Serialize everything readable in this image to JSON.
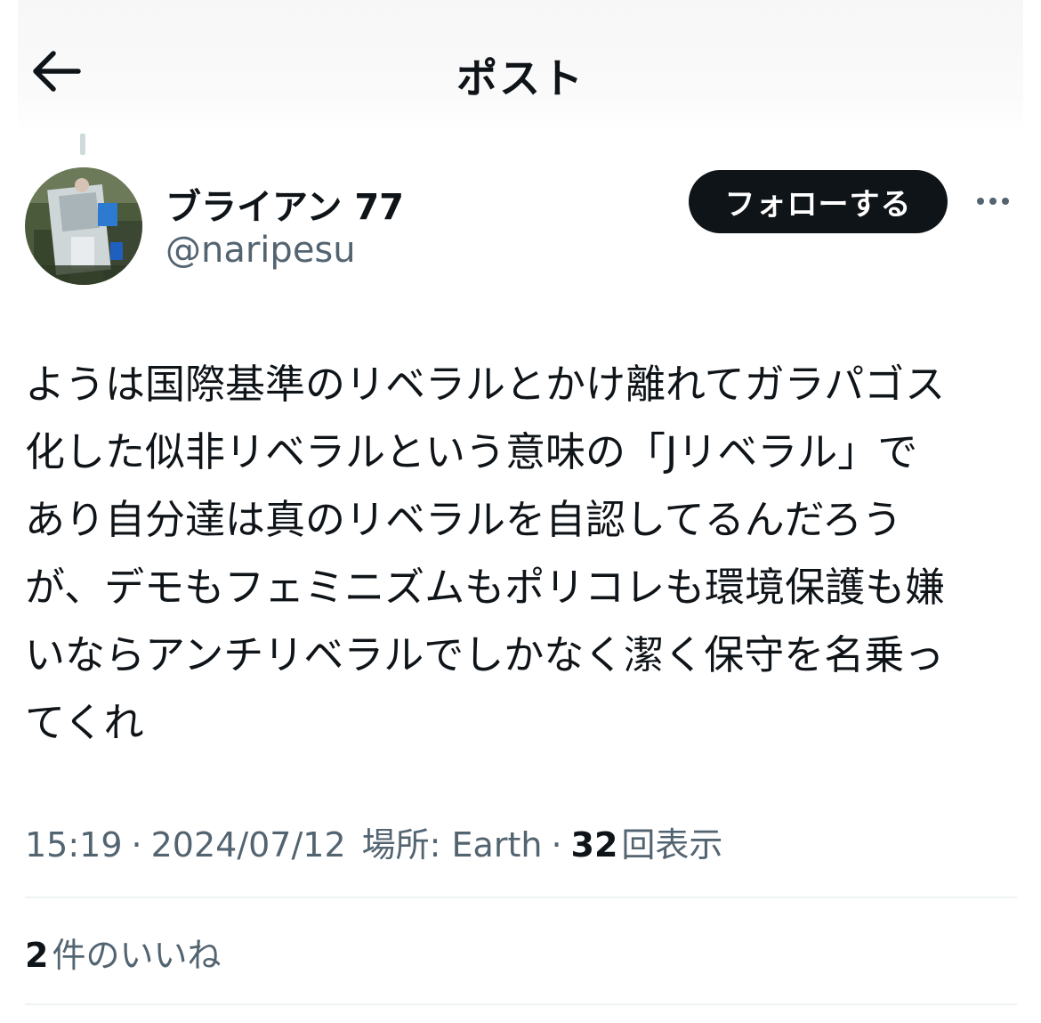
{
  "header": {
    "title": "ポスト",
    "back_icon": "arrow-left-icon"
  },
  "author": {
    "display_name": "ブライアン 77",
    "handle": "@naripesu",
    "avatar_icon": "profile-photo"
  },
  "actions": {
    "follow_label": "フォローする",
    "more_icon": "ellipsis-icon"
  },
  "post": {
    "lines": [
      "ようは国際基準のリベラルとかけ離れてガラパゴス",
      "化した似非リベラルという意味の「Jリベラル」で",
      "あり自分達は真のリベラルを自認してるんだろう",
      "が、デモもフェミニズムもポリコレも環境保護も嫌",
      "いならアンチリベラルでしかなく潔く保守を名乗っ",
      "てくれ"
    ]
  },
  "meta": {
    "time": "15:19",
    "date": "2024/07/12",
    "location_label": "場所: Earth",
    "separator": "·",
    "views_count": "32",
    "views_label": "回表示"
  },
  "engagement": {
    "likes_count": "2",
    "likes_label": "件のいいね"
  },
  "colors": {
    "primary_text": "#0f1419",
    "secondary_text": "#536471",
    "divider": "#eff3f4",
    "button_bg": "#0f1419"
  }
}
